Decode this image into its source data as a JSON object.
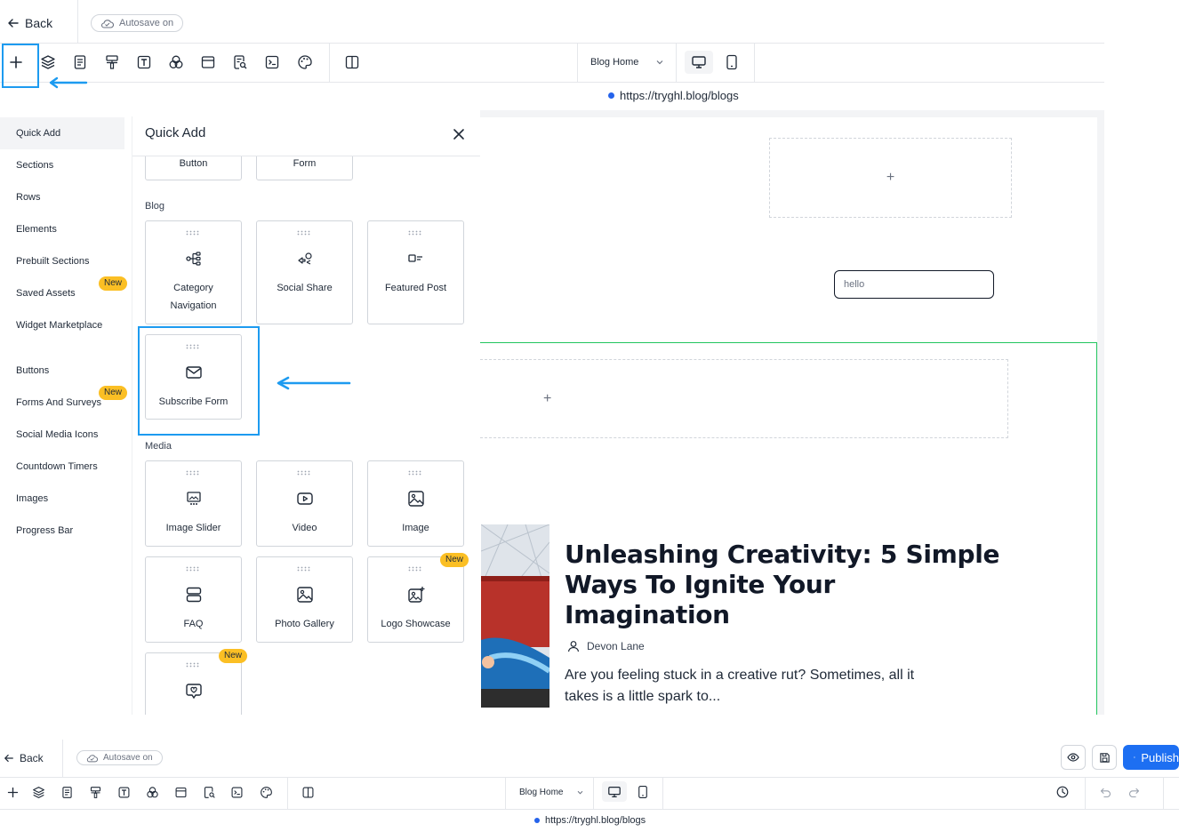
{
  "header": {
    "back_label": "Back",
    "autosave_label": "Autosave on",
    "page_select": "Blog Home",
    "url": "https://tryghl.blog/blogs"
  },
  "toolbar_icons": [
    "add-icon",
    "layers-icon",
    "page-icon",
    "paint-roller-icon",
    "text-icon",
    "color-circles-icon",
    "layout-icon",
    "search-doc-icon",
    "code-icon",
    "palette-icon",
    "split-view-icon"
  ],
  "leftnav": {
    "items": [
      {
        "label": "Quick Add",
        "active": true
      },
      {
        "label": "Sections"
      },
      {
        "label": "Rows"
      },
      {
        "label": "Elements"
      },
      {
        "label": "Prebuilt Sections"
      },
      {
        "label": "Saved Assets",
        "badge": "New"
      },
      {
        "label": "Widget Marketplace"
      },
      {
        "label": "Buttons"
      },
      {
        "label": "Forms And Surveys",
        "badge": "New"
      },
      {
        "label": "Social Media Icons"
      },
      {
        "label": "Countdown Timers"
      },
      {
        "label": "Images"
      },
      {
        "label": "Progress Bar"
      }
    ]
  },
  "panel": {
    "title": "Quick Add",
    "top_cards": [
      "Button",
      "Form"
    ],
    "blog_label": "Blog",
    "blog_cards": [
      {
        "line1": "Category",
        "line2": "Navigation",
        "icon": "tree-icon"
      },
      {
        "line1": "Social Share",
        "icon": "share-icon"
      },
      {
        "line1": "Featured Post",
        "icon": "featured-post-icon"
      },
      {
        "line1": "Subscribe Form",
        "icon": "envelope-icon"
      }
    ],
    "media_label": "Media",
    "media_cards": [
      {
        "label": "Image Slider",
        "icon": "slider-icon"
      },
      {
        "label": "Video",
        "icon": "video-icon"
      },
      {
        "label": "Image",
        "icon": "image-icon"
      },
      {
        "label": "FAQ",
        "icon": "faq-icon"
      },
      {
        "label": "Photo Gallery",
        "icon": "gallery-icon"
      },
      {
        "label": "Logo Showcase",
        "icon": "logo-showcase-icon",
        "badge": "New"
      },
      {
        "label": "",
        "icon": "testimonial-icon",
        "badge": "New"
      }
    ]
  },
  "canvas": {
    "input_placeholder": "hello",
    "blog_title_lines": [
      "Unleashing Creativity: 5 Simple",
      "Ways To Ignite Your",
      "Imagination"
    ],
    "author": "Devon Lane",
    "excerpt_lines": [
      "Are you feeling stuck in a creative rut? Sometimes, all it",
      "takes is a little spark to..."
    ]
  },
  "bottom_header": {
    "back_label": "Back",
    "autosave_label": "Autosave on",
    "page_select": "Blog Home",
    "url": "https://tryghl.blog/blogs",
    "publish_label": "Publish"
  },
  "colors": {
    "accent": "#1d9bf0",
    "publish": "#1d6ff2",
    "badge": "#fbbf24",
    "section_outline": "#22c55e"
  }
}
